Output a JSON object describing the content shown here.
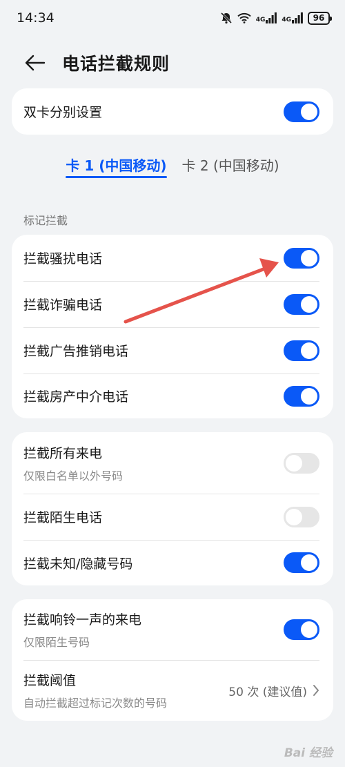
{
  "status_bar": {
    "time": "14:34",
    "network_1": "4G",
    "network_2": "4G",
    "battery": "96",
    "icons": [
      "mute-bell-icon",
      "wifi-icon",
      "signal-icon",
      "signal-icon",
      "battery-icon"
    ]
  },
  "header": {
    "back_icon": "arrow-left-icon",
    "title": "电话拦截规则"
  },
  "dual_sim": {
    "label": "双卡分别设置",
    "on": true
  },
  "tabs": [
    {
      "label": "卡 1 (中国移动)",
      "active": true
    },
    {
      "label": "卡 2 (中国移动)",
      "active": false
    }
  ],
  "section_marked": {
    "title": "标记拦截",
    "items": [
      {
        "label": "拦截骚扰电话",
        "on": true
      },
      {
        "label": "拦截诈骗电话",
        "on": true
      },
      {
        "label": "拦截广告推销电话",
        "on": true
      },
      {
        "label": "拦截房产中介电话",
        "on": true
      }
    ]
  },
  "section_calls": {
    "items": [
      {
        "label": "拦截所有来电",
        "sub": "仅限白名单以外号码",
        "on": false
      },
      {
        "label": "拦截陌生电话",
        "on": false
      },
      {
        "label": "拦截未知/隐藏号码",
        "on": true
      }
    ]
  },
  "section_ring": {
    "ring_once": {
      "label": "拦截响铃一声的来电",
      "sub": "仅限陌生号码",
      "on": true
    },
    "threshold": {
      "label": "拦截阈值",
      "sub": "自动拦截超过标记次数的号码",
      "value": "50 次 (建议值)"
    }
  },
  "colors": {
    "accent": "#0a59f7",
    "annotation_arrow": "#e5534b"
  },
  "watermark": "Bai 经验"
}
